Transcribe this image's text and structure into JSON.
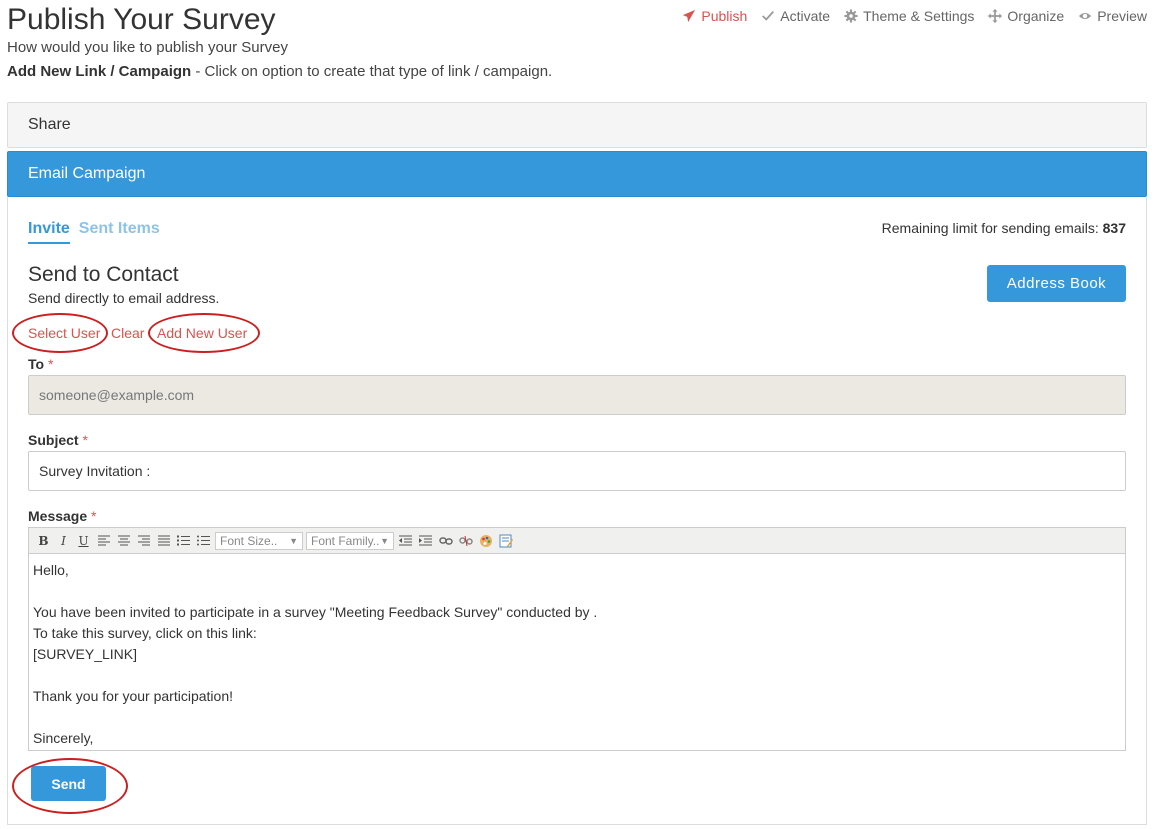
{
  "header": {
    "title": "Publish Your Survey",
    "subtitle": "How would you like to publish your Survey",
    "add_bold": "Add New Link / Campaign",
    "add_rest": " - Click on option to create that type of link / campaign."
  },
  "topnav": {
    "publish": "Publish",
    "activate": "Activate",
    "theme": "Theme & Settings",
    "organize": "Organize",
    "preview": "Preview"
  },
  "panels": {
    "share": "Share",
    "email_campaign": "Email Campaign"
  },
  "tabs": {
    "invite": "Invite",
    "sent_items": "Sent Items"
  },
  "limit": {
    "label": "Remaining limit for sending emails: ",
    "value": "837"
  },
  "send_contact": {
    "title": "Send to Contact",
    "desc": "Send directly to email address.",
    "address_book": "Address Book",
    "select_user": "Select User",
    "clear": "Clear",
    "add_new_user": "Add New User"
  },
  "form": {
    "to_label": "To",
    "to_placeholder": "someone@example.com",
    "subject_label": "Subject",
    "subject_value": "Survey Invitation :",
    "message_label": "Message",
    "required_mark": "*",
    "font_size": "Font Size..",
    "font_family": "Font Family..",
    "message_body": "Hello,\n\nYou have been invited to participate in a survey \"Meeting Feedback Survey\" conducted by .\nTo take this survey, click on this link:\n[SURVEY_LINK]\n\nThank you for your participation!\n\nSincerely,",
    "send": "Send"
  },
  "colors": {
    "accent": "#3498db",
    "danger": "#d9534f",
    "annotation": "#cc1f1f"
  }
}
